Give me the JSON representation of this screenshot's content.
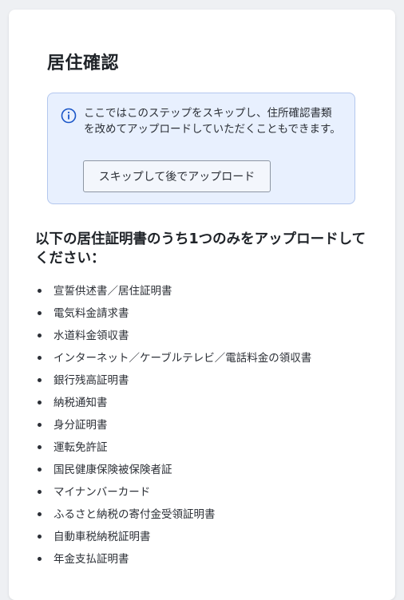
{
  "page": {
    "title": "居住確認"
  },
  "info": {
    "icon": "info-circle-icon",
    "accent_color": "#1a56c8",
    "message": "ここではこのステップをスキップし、住所確認書類を改めてアップロードしていただくこともできます。",
    "skip_button_label": "スキップして後でアップロード"
  },
  "documents": {
    "heading": "以下の居住証明書のうち1つのみをアップロードしてください：",
    "items": [
      "宣誓供述書／居住証明書",
      "電気料金請求書",
      "水道料金領収書",
      "インターネット／ケーブルテレビ／電話料金の領収書",
      "銀行残高証明書",
      "納税通知書",
      "身分証明書",
      "運転免許証",
      "国民健康保険被保険者証",
      "マイナンバーカード",
      "ふるさと納税の寄付金受領証明書",
      "自動車税納税証明書",
      "年金支払証明書"
    ]
  }
}
